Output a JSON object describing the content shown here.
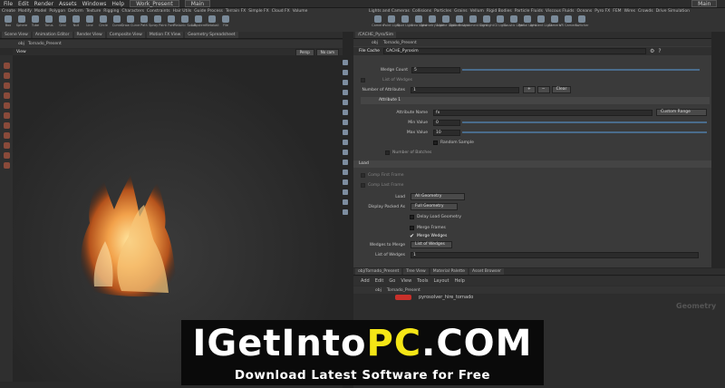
{
  "menu": {
    "items": [
      "File",
      "Edit",
      "Render",
      "Assets",
      "Windows",
      "Help"
    ],
    "desktop": "Work_Present",
    "scene": "Main",
    "main_right": "Main"
  },
  "shelf": {
    "tabs_left": [
      "Create",
      "Modify",
      "Model",
      "Polygon",
      "Deform",
      "Texture",
      "Rigging",
      "Characters",
      "Constraints",
      "Hair Utils",
      "Guide Process",
      "Terrain FX",
      "Simple FX",
      "Cloud FX",
      "Volume"
    ],
    "tools_left": [
      "Box",
      "Sphere",
      "Tube",
      "Torus",
      "Grid",
      "Null",
      "Line",
      "Circle",
      "Curve",
      "Draw Curve",
      "Path",
      "Spray Paint",
      "Font",
      "Platonic Solids",
      "L-System",
      "Metaball",
      "File"
    ],
    "tabs_right": [
      "Lights and Cameras",
      "Collisions",
      "Particles",
      "Grains",
      "Vellum",
      "Rigid Bodies",
      "Particle Fluids",
      "Viscous Fluids",
      "Oceans",
      "Pyro FX",
      "FEM",
      "Wires",
      "Crowds",
      "Drive Simulation"
    ],
    "tools_right": [
      "Camera",
      "Point Light",
      "Spot Light",
      "Area Light",
      "Geometry Light",
      "Volume Light",
      "Distant Light",
      "Environment Light",
      "Sky Light",
      "GI Light",
      "Caustic Light",
      "Portal Light",
      "Ambient Light",
      "Camera",
      "VR Camera",
      "Switcher"
    ]
  },
  "viewport": {
    "tabs": [
      "Scene View",
      "Animation Editor",
      "Render View",
      "Composite View",
      "Motion FX View",
      "Geometry Spreadsheet"
    ],
    "path": "obj",
    "node": "Tornado_Present",
    "label": "View",
    "persp": "Persp",
    "cam": "No cam"
  },
  "params": {
    "tabs": [
      "/CACHE_Pyro/Sim"
    ],
    "path": "obj",
    "node": "Tornado_Present",
    "header_type": "File Cache",
    "header_name": "CACHE_Pyrosim",
    "wedge_count_label": "Wedge Count",
    "wedge_count": "5",
    "list_wedges_label": "List of Wedges",
    "num_attr_label": "Number of Attributes",
    "num_attr": "1",
    "clear": "Clear",
    "attr_section": "Attribute 1",
    "attr_name_label": "Attribute Name",
    "attr_name": "fx",
    "custom_range": "Custom Range",
    "min_label": "Min Value",
    "min": "0",
    "max_label": "Max Value",
    "max": "10",
    "random_sample": "Random Sample",
    "num_batches": "Number of Batches",
    "load_section": "Load",
    "comp_first": "Comp First Frame",
    "comp_last": "Comp Last Frame",
    "load_label": "Load",
    "load_val": "All Geometry",
    "display_label": "Display Packed As",
    "display_val": "Full Geometry",
    "delay_load": "Delay Load Geometry",
    "merge_frames": "Merge Frames",
    "merge_wedges": "Merge Wedges",
    "wedges_merge_label": "Wedges to Merge",
    "wedges_merge_val": "List of Wedges",
    "list_wedges2": "List of Wedges",
    "list_wedges2_val": "1"
  },
  "network": {
    "tabs": [
      "obj/Tornado_Present",
      "Tree View",
      "Material Palette",
      "Asset Browser"
    ],
    "menu": [
      "Add",
      "Edit",
      "Go",
      "View",
      "Tools",
      "Layout",
      "Help"
    ],
    "path": "obj",
    "node": "Tornado_Present",
    "node_name": "pyrosolver_hire_tornado",
    "context": "Geometry"
  },
  "watermark": {
    "line1_a": "IGetInto",
    "line1_b": "PC",
    "line1_c": ".COM",
    "line2": "Download Latest Software for Free"
  }
}
